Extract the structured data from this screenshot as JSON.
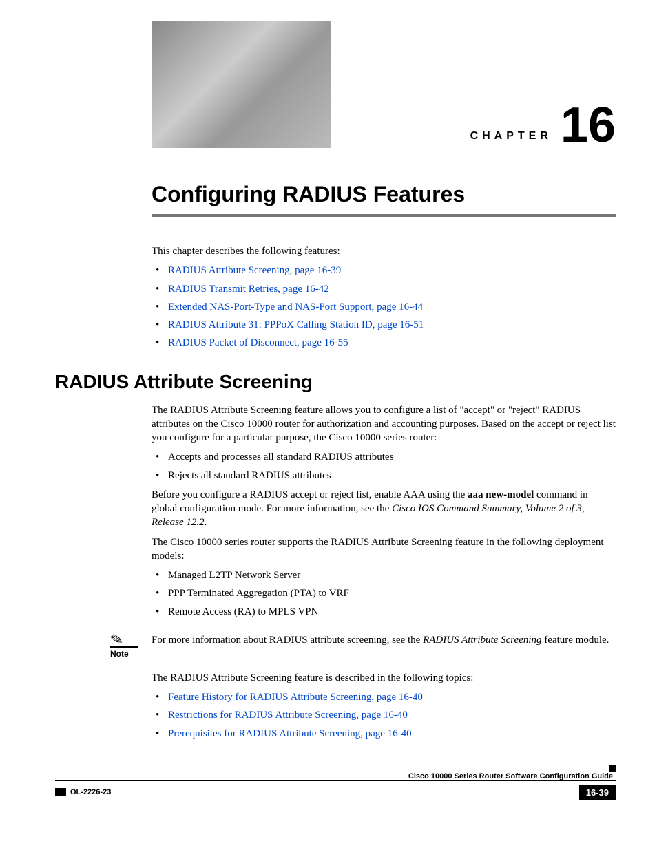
{
  "header": {
    "chapter_label": "CHAPTER",
    "chapter_number": "16"
  },
  "title": "Configuring RADIUS Features",
  "intro": "This chapter describes the following features:",
  "toc": [
    "RADIUS Attribute Screening, page 16-39",
    "RADIUS Transmit Retries, page 16-42",
    "Extended NAS-Port-Type and NAS-Port Support, page 16-44",
    "RADIUS Attribute 31: PPPoX Calling Station ID, page 16-51",
    "RADIUS Packet of Disconnect, page 16-55"
  ],
  "section": {
    "heading": "RADIUS Attribute Screening",
    "p1": "The RADIUS Attribute Screening feature allows you to configure a list of \"accept\" or \"reject\" RADIUS attributes on the Cisco 10000 router for authorization and accounting purposes. Based on the accept or reject list you configure for a particular purpose, the Cisco 10000 series router:",
    "list1": [
      "Accepts and processes all standard RADIUS attributes",
      "Rejects all standard RADIUS attributes"
    ],
    "p2_a": "Before you configure a RADIUS accept or reject list, enable AAA using the ",
    "p2_b_bold": "aaa new-model",
    "p2_c": " command in global configuration mode. For more information, see the ",
    "p2_d_italic": "Cisco IOS Command Summary, Volume 2 of 3, Release 12.2",
    "p2_e": ".",
    "p3": "The Cisco 10000 series router supports the RADIUS Attribute Screening feature in the following deployment models:",
    "list2": [
      "Managed L2TP Network Server",
      "PPP Terminated Aggregation (PTA) to VRF",
      "Remote Access (RA) to MPLS VPN"
    ],
    "note_label": "Note",
    "note_a": "For more information about RADIUS attribute screening, see the ",
    "note_b_italic": "RADIUS Attribute Screening",
    "note_c": " feature module.",
    "p4": "The RADIUS Attribute Screening feature is described in the following topics:",
    "list3": [
      "Feature History for RADIUS Attribute Screening, page 16-40",
      "Restrictions for RADIUS Attribute Screening, page 16-40",
      "Prerequisites for RADIUS Attribute Screening, page 16-40"
    ]
  },
  "footer": {
    "guide": "Cisco 10000 Series Router Software Configuration Guide",
    "doc_id": "OL-2226-23",
    "page": "16-39"
  }
}
